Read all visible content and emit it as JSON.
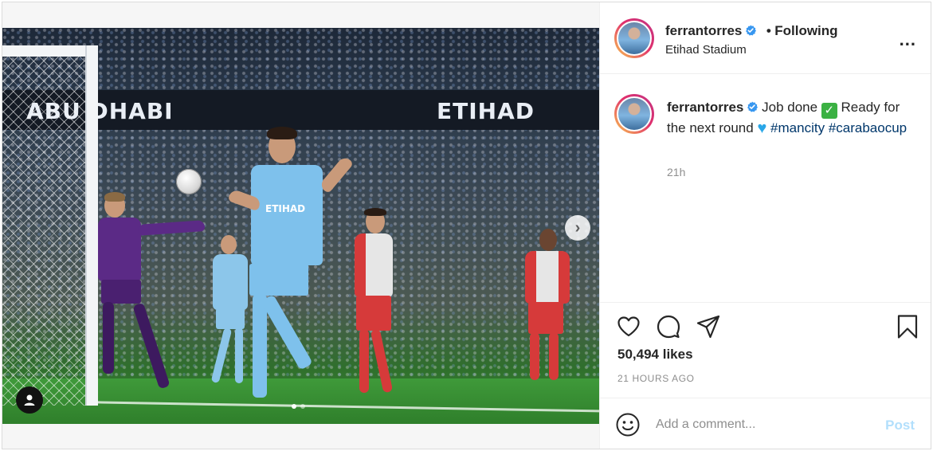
{
  "media": {
    "board_left": "ABU DHABI",
    "board_right": "ETIHAD",
    "shirt_text": "ETIHAD",
    "slides_total": 2,
    "slide_active": 1
  },
  "post": {
    "username": "ferrantorres",
    "follow_separator": "•",
    "follow_status": "Following",
    "location": "Etihad Stadium",
    "more_label": "...",
    "caption": {
      "username": "ferrantorres",
      "text_before": "Job done",
      "text_middle": "Ready for the next round",
      "hashtags": [
        "#mancity",
        "#carabaocup"
      ],
      "time": "21h"
    },
    "likes": "50,494 likes",
    "posted_ago": "21 HOURS AGO",
    "comment_placeholder": "Add a comment...",
    "post_button": "Post"
  },
  "colors": {
    "verified": "#3897f0",
    "hashtag": "#00376b",
    "post_button_disabled": "#b2dffc",
    "meta_text": "#8e8e8e"
  },
  "icons": {
    "heart": "heart-icon",
    "comment": "comment-icon",
    "share": "share-icon",
    "save": "bookmark-icon",
    "emoji": "smiley-icon",
    "next": "chevron-right-icon",
    "tag": "user-tag-icon",
    "more": "more-options-icon"
  }
}
